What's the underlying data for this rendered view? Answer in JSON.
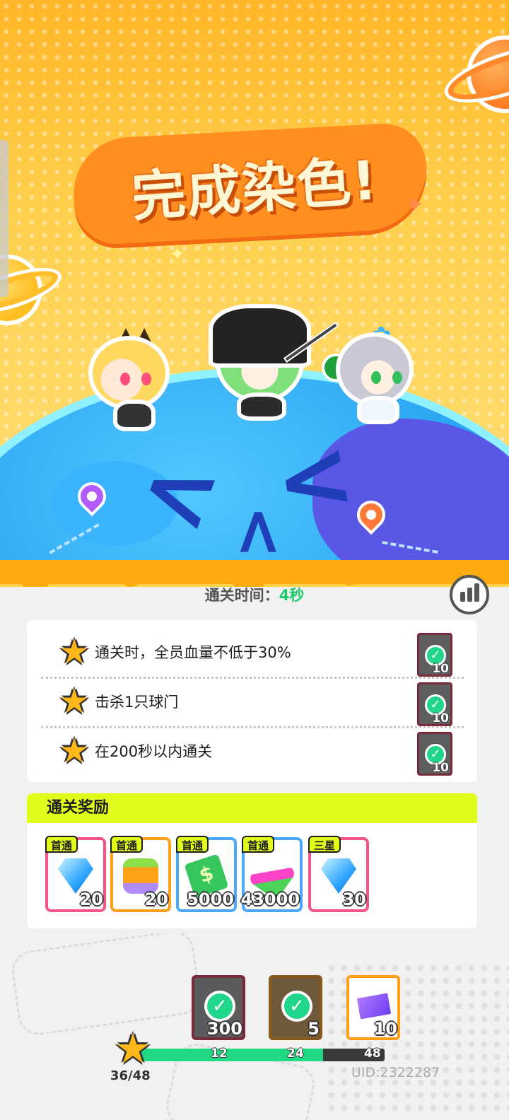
{
  "banner": {
    "title": "完成染色!"
  },
  "clear_time": {
    "label": "通关时间：",
    "value": "4秒"
  },
  "objectives": [
    {
      "text": "通关时，全员血量不低于30%",
      "reward_qty": "10",
      "completed": true
    },
    {
      "text": "击杀1只球门",
      "reward_qty": "10",
      "completed": true
    },
    {
      "text": "在200秒以内通关",
      "reward_qty": "10",
      "completed": true
    }
  ],
  "rewards": {
    "title": "通关奖励",
    "items": [
      {
        "tag": "首通",
        "icon": "diamond-icon",
        "qty": "20",
        "border": "#f2548c"
      },
      {
        "tag": "首通",
        "icon": "bottle-icon",
        "qty": "20",
        "border": "#ff9f1a"
      },
      {
        "tag": "首通",
        "icon": "cash-icon",
        "qty": "5000",
        "border": "#4aa8ff"
      },
      {
        "tag": "首通",
        "icon": "paint-tube-icon",
        "qty": "43000",
        "border": "#4aa8ff"
      },
      {
        "tag": "三星",
        "icon": "diamond-icon",
        "qty": "30",
        "border": "#f2548c"
      }
    ]
  },
  "milestones": {
    "items": [
      {
        "icon": "gem-pack-icon",
        "qty": "300",
        "claimed": true,
        "border": "#7b2a3c"
      },
      {
        "icon": "ticket-icon",
        "qty": "5",
        "claimed": true,
        "border": "#8a5a1c"
      },
      {
        "icon": "ticket-icon",
        "qty": "10",
        "claimed": false,
        "border": "#ff9f1a"
      }
    ],
    "marks": [
      "12",
      "24",
      "48"
    ],
    "progress": 0.75,
    "count": "36/48"
  },
  "uid": "UID:2322287",
  "colors": {
    "accent_green": "#21c96b",
    "accent_yellow": "#e1fb1a",
    "hero_orange": "#ff8f1f"
  }
}
